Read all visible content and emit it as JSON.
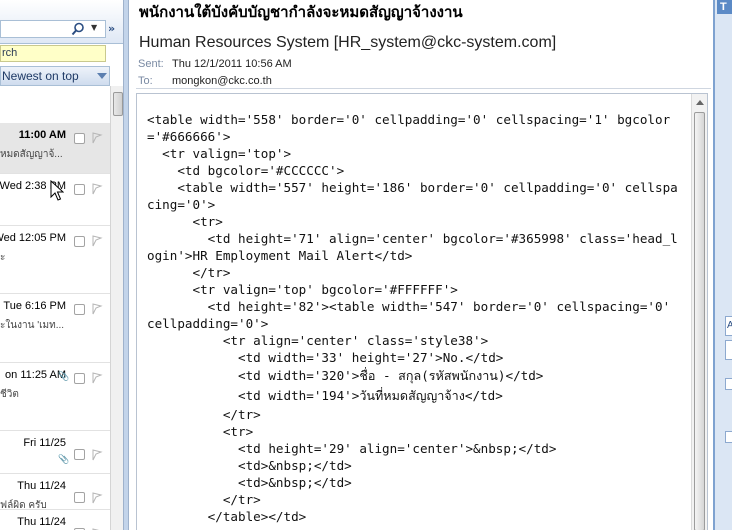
{
  "list": {
    "search_placeholder": "rch",
    "sort_label": "Newest on top",
    "messages": [
      {
        "time": "11:00 AM",
        "preview": "หมดสัญญาจ้...",
        "attachment": false
      },
      {
        "time": "Wed 2:38 PM",
        "preview": "",
        "attachment": false
      },
      {
        "time": "Wed 12:05 PM",
        "preview": "ะ",
        "attachment": false
      },
      {
        "time": "Tue 6:16 PM",
        "preview": "ะในงาน 'เมท...",
        "attachment": false
      },
      {
        "time": "on 11:25 AM",
        "preview": "ชีวิต",
        "attachment": true
      },
      {
        "time": "Fri 11/25",
        "preview": "",
        "attachment": true
      },
      {
        "time": "Thu 11/24",
        "preview": "ฟล์ผิด ครับ",
        "attachment": false
      },
      {
        "time": "Thu 11/24",
        "preview": "",
        "attachment": false
      }
    ]
  },
  "message": {
    "subject": "พนักงานใต้บังคับบัญชากำลังจะหมดสัญญาจ้างงาน",
    "from": "Human Resources System [HR_system@ckc-system.com]",
    "sent_label": "Sent:",
    "sent_value": "Thu 12/1/2011 10:56 AM",
    "to_label": "To:",
    "to_value": "mongkon@ckc.co.th",
    "body_lines": [
      "<table width='558' border='0' cellpadding='0' cellspacing='1' bgcolor='#666666'>",
      "  <tr valign='top'>",
      "    <td bgcolor='#CCCCCC'>",
      "    <table width='557' height='186' border='0' cellpadding='0' cellspacing='0'>",
      "      <tr>",
      "        <td height='71' align='center' bgcolor='#365998' class='head_login'>HR Employment Mail Alert</td>",
      "      </tr>",
      "      <tr valign='top' bgcolor='#FFFFFF'>",
      "        <td height='82'><table width='547' border='0' cellspacing='0' cellpadding='0'>",
      "          <tr align='center' class='style38'>",
      "            <td width='33' height='27'>No.</td>",
      "            <td width='320'>ชื่อ - สกุล(รหัสพนักงาน)</td>",
      "            <td width='194'>วันที่หมดสัญญาจ้าง</td>",
      "          </tr>",
      "          <tr>",
      "            <td height='29' align='center'>&nbsp;</td>",
      "            <td>&nbsp;</td>",
      "            <td>&nbsp;</td>",
      "          </tr>",
      "        </table></td>"
    ]
  },
  "right_panel": {
    "tab_label": "T",
    "letter_a": "A"
  }
}
